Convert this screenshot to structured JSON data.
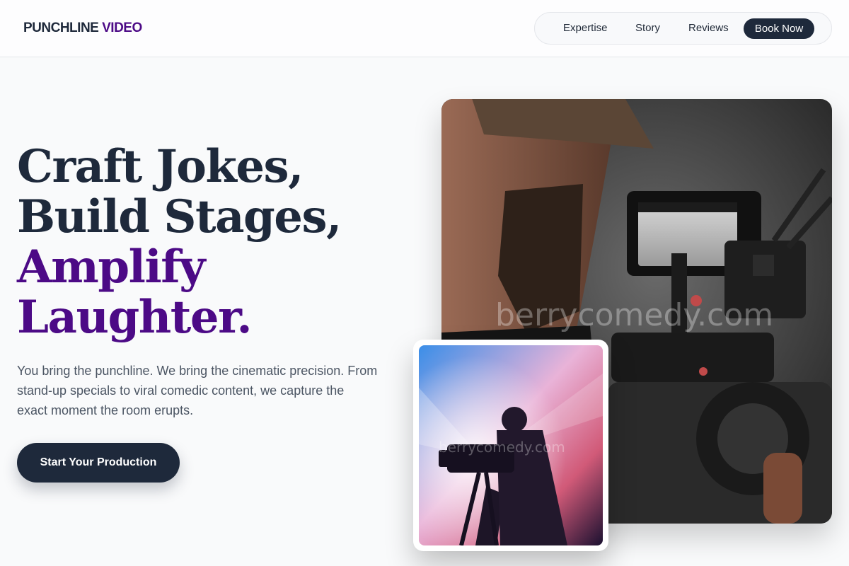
{
  "brand": {
    "name": "PUNCHLINE",
    "accent": "VIDEO"
  },
  "nav": {
    "items": [
      {
        "label": "Expertise"
      },
      {
        "label": "Story"
      },
      {
        "label": "Reviews"
      }
    ],
    "cta_label": "Book Now"
  },
  "hero": {
    "headline": {
      "line1": "Craft Jokes,",
      "line2": "Build Stages,",
      "line3": "Amplify",
      "line4": "Laughter."
    },
    "lede": "You bring the punchline. We bring the cinematic precision. From stand-up specials to viral comedic content, we capture the exact moment the room erupts.",
    "cta_label": "Start Your Production"
  },
  "images": {
    "main_watermark": "berrycomedy.com",
    "small_watermark": "berrycomedy.com"
  },
  "colors": {
    "primary": "#1e293b",
    "accent": "#4c0a86",
    "background": "#f9fafb"
  }
}
